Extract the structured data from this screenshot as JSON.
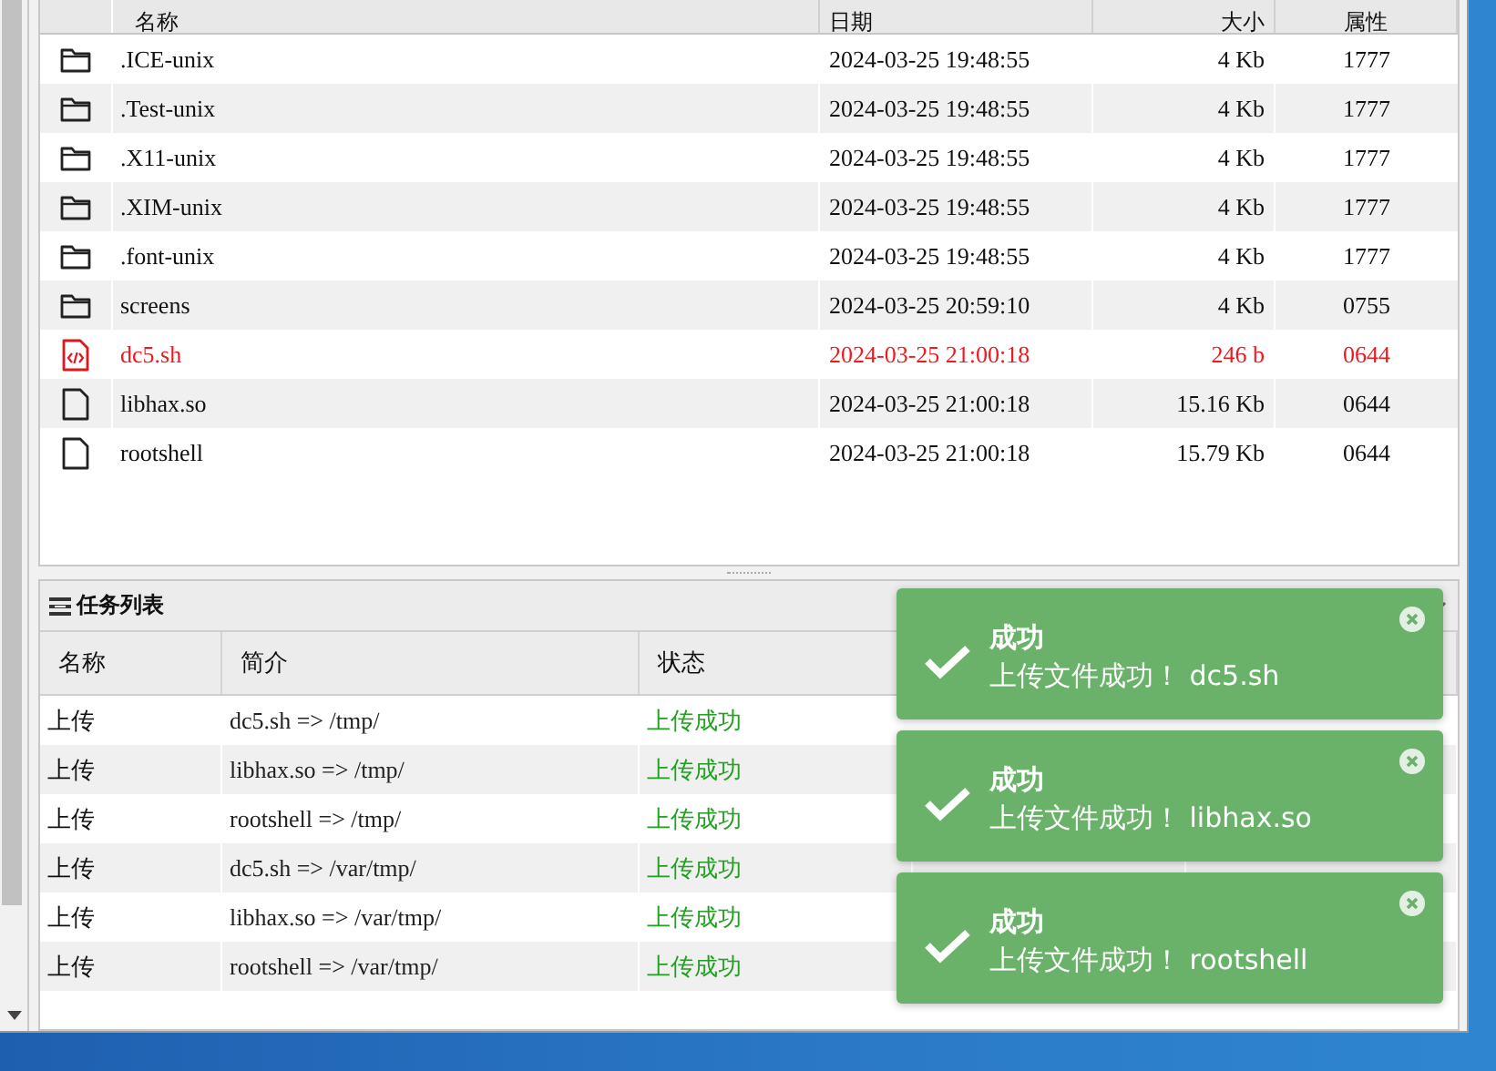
{
  "files": {
    "columns": [
      "名称",
      "日期",
      "大小",
      "属性"
    ],
    "rows": [
      {
        "kind": "folder",
        "name": ".ICE-unix",
        "date": "2024-03-25 19:48:55",
        "size": "4 Kb",
        "attr": "1777",
        "highlighted": false
      },
      {
        "kind": "folder",
        "name": ".Test-unix",
        "date": "2024-03-25 19:48:55",
        "size": "4 Kb",
        "attr": "1777",
        "highlighted": false
      },
      {
        "kind": "folder",
        "name": ".X11-unix",
        "date": "2024-03-25 19:48:55",
        "size": "4 Kb",
        "attr": "1777",
        "highlighted": false
      },
      {
        "kind": "folder",
        "name": ".XIM-unix",
        "date": "2024-03-25 19:48:55",
        "size": "4 Kb",
        "attr": "1777",
        "highlighted": false
      },
      {
        "kind": "folder",
        "name": ".font-unix",
        "date": "2024-03-25 19:48:55",
        "size": "4 Kb",
        "attr": "1777",
        "highlighted": false
      },
      {
        "kind": "folder",
        "name": "screens",
        "date": "2024-03-25 20:59:10",
        "size": "4 Kb",
        "attr": "0755",
        "highlighted": false
      },
      {
        "kind": "script",
        "name": "dc5.sh",
        "date": "2024-03-25 21:00:18",
        "size": "246 b",
        "attr": "0644",
        "highlighted": true
      },
      {
        "kind": "file",
        "name": "libhax.so",
        "date": "2024-03-25 21:00:18",
        "size": "15.16 Kb",
        "attr": "0644",
        "highlighted": false
      },
      {
        "kind": "file",
        "name": "rootshell",
        "date": "2024-03-25 21:00:18",
        "size": "15.79 Kb",
        "attr": "0644",
        "highlighted": false
      }
    ]
  },
  "tasks": {
    "title": "任务列表",
    "columns": [
      "名称",
      "简介",
      "状态"
    ],
    "rows": [
      {
        "name": "上传",
        "desc": "dc5.sh => /tmp/",
        "status": "上传成功"
      },
      {
        "name": "上传",
        "desc": "libhax.so => /tmp/",
        "status": "上传成功"
      },
      {
        "name": "上传",
        "desc": "rootshell => /tmp/",
        "status": "上传成功"
      },
      {
        "name": "上传",
        "desc": "dc5.sh => /var/tmp/",
        "status": "上传成功"
      },
      {
        "name": "上传",
        "desc": "libhax.so => /var/tmp/",
        "status": "上传成功"
      },
      {
        "name": "上传",
        "desc": "rootshell => /var/tmp/",
        "status": "上传成功"
      }
    ]
  },
  "toasts": [
    {
      "title": "成功",
      "message": "上传文件成功！ dc5.sh"
    },
    {
      "title": "成功",
      "message": "上传文件成功！ libhax.so"
    },
    {
      "title": "成功",
      "message": "上传文件成功！ rootshell"
    }
  ]
}
